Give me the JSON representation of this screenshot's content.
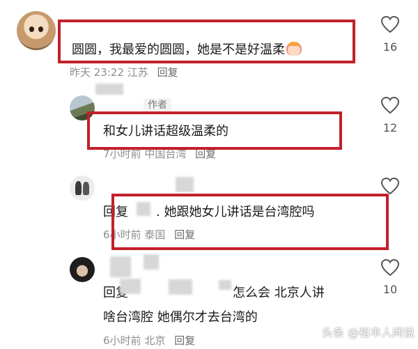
{
  "comments": [
    {
      "text": "圆圆，我最爱的圆圆，她是不是好温柔",
      "time": "昨天 23:22",
      "location": "江苏",
      "reply_label": "回复",
      "likes": "16"
    },
    {
      "tag": "作者",
      "text": "和女儿讲话超级温柔的",
      "time": "7小时前",
      "location": "中国台湾",
      "reply_label": "回复",
      "likes": "12"
    },
    {
      "text_prefix": "回复",
      "text": ". 她跟她女儿讲话是台湾腔吗",
      "time": "6小时前",
      "location": "泰国",
      "reply_label": "回复"
    },
    {
      "text_prefix": "回复",
      "text_line1": "怎么会 北京人讲",
      "text_line2": "啥台湾腔 她偶尔才去台湾的",
      "time": "6小时前",
      "location": "北京",
      "reply_label": "回复",
      "likes": "10"
    }
  ],
  "watermark": "头条 @裕丰人间说",
  "colors": {
    "highlight_box": "#c2202a",
    "meta": "#8d8d8d"
  },
  "icons": {
    "like": "heart-outline-icon"
  }
}
